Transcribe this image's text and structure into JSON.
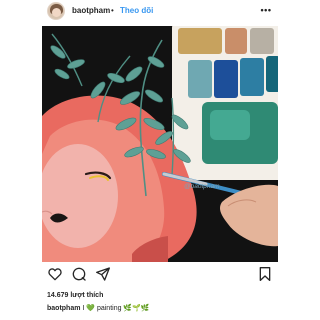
{
  "post": {
    "username": "baotpham",
    "separator": "•",
    "follow_label": "Theo dõi",
    "more_label": "•••",
    "likes": "14.679 lượt thích",
    "caption_user": "baotpham",
    "caption_text": "I 💚 painting 🌿🌱🌿",
    "image_signature": "@baotpham"
  },
  "icons": {
    "like": "heart-icon",
    "comment": "comment-icon",
    "share": "send-icon",
    "save": "bookmark-icon"
  },
  "colors": {
    "link_blue": "#3897f0",
    "text": "#262626",
    "skin_pink": "#ef7f73",
    "leaf_teal": "#5ea095"
  }
}
